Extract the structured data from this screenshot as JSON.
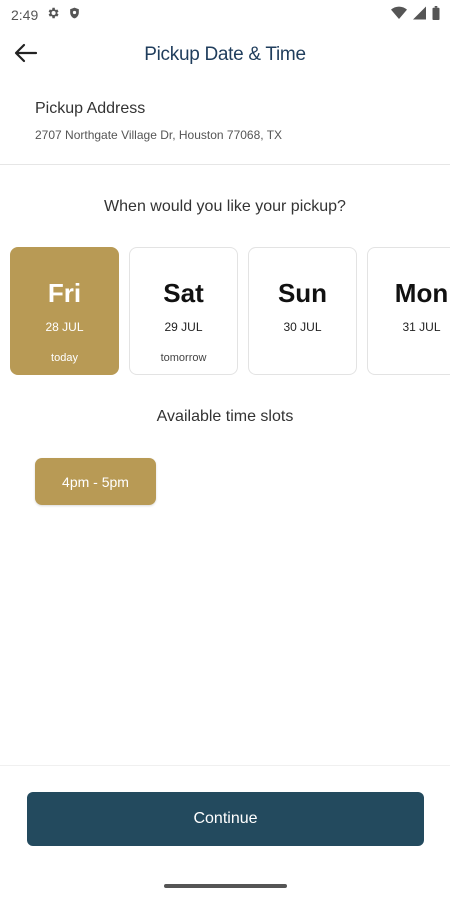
{
  "status_bar": {
    "time": "2:49",
    "left_icons": [
      "settings-icon",
      "shield-icon"
    ],
    "right_icons": [
      "wifi-icon",
      "signal-icon",
      "battery-icon"
    ]
  },
  "header": {
    "back_icon": "arrow-left-icon",
    "title": "Pickup Date & Time"
  },
  "address": {
    "label": "Pickup Address",
    "value": "2707 Northgate Village Dr, Houston 77068, TX"
  },
  "question": "When would you like your pickup?",
  "days": [
    {
      "day": "Fri",
      "date": "28 JUL",
      "note": "today",
      "selected": true
    },
    {
      "day": "Sat",
      "date": "29 JUL",
      "note": "tomorrow",
      "selected": false
    },
    {
      "day": "Sun",
      "date": "30 JUL",
      "note": "",
      "selected": false
    },
    {
      "day": "Mon",
      "date": "31 JUL",
      "note": "",
      "selected": false
    }
  ],
  "slots": {
    "title": "Available time slots",
    "items": [
      {
        "label": "4pm - 5pm",
        "selected": true
      }
    ]
  },
  "continue_label": "Continue",
  "colors": {
    "accent_gold": "#b89a55",
    "primary_button": "#234a5e",
    "title_text": "#1f3d5c"
  }
}
